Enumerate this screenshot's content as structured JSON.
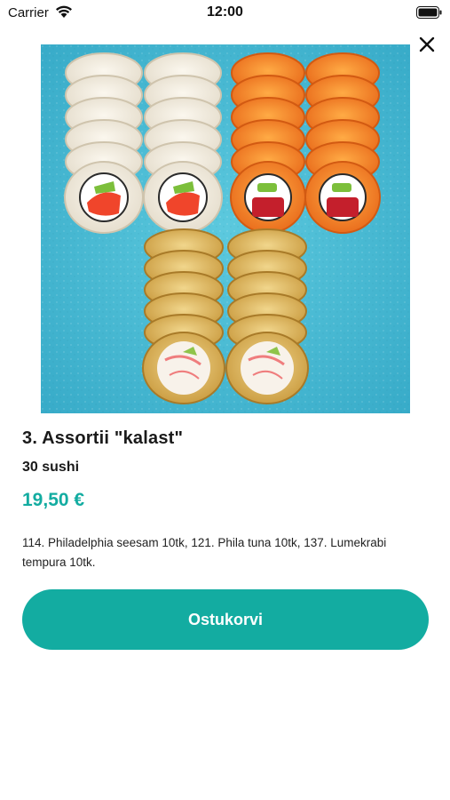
{
  "status_bar": {
    "carrier": "Carrier",
    "time": "12:00",
    "icons": [
      "wifi-icon",
      "battery-icon"
    ]
  },
  "header": {
    "close_icon": "close-icon"
  },
  "product": {
    "image_alt": "sushi-set-photo",
    "title": "3. Assortii \"kalast\"",
    "count": "30 sushi",
    "price": "19,50 €",
    "description": "114. Philadelphia seesam 10tk, 121. Phila tuna 10tk, 137. Lumekrabi tempura 10tk."
  },
  "actions": {
    "cart_label": "Ostukorvi"
  },
  "colors": {
    "accent": "#13aca1",
    "image_background": "#4fc1d8"
  }
}
